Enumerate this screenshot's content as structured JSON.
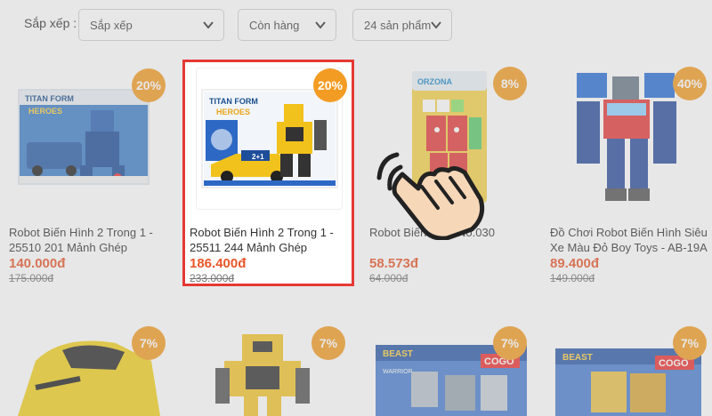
{
  "filters": {
    "sort_label": "Sắp xếp :",
    "sort_value": "Sắp xếp",
    "stock_value": "Còn hàng",
    "count_value": "24 sản phẩm"
  },
  "products": [
    {
      "name_line1": "Robot Biến Hình 2 Trong 1 -",
      "name_line2": "25510 201 Mảnh Ghép",
      "price": "140.000đ",
      "old_price": "175.000đ",
      "discount": "20%"
    },
    {
      "name_line1": "Robot Biến Hình 2 Trong 1 -",
      "name_line2": "25511 244 Mảnh Ghép",
      "price": "186.400đ",
      "old_price": "233.000đ",
      "discount": "20%"
    },
    {
      "name_line1": "Robot Biến Hình No.030",
      "name_line2": "",
      "price": "58.573đ",
      "old_price": "64.000đ",
      "discount": "8%"
    },
    {
      "name_line1": "Đồ Chơi Robot Biến Hình Siêu",
      "name_line2": "Xe Màu Đỏ Boy Toys - AB-19A",
      "price": "89.400đ",
      "old_price": "149.000đ",
      "discount": "40%"
    }
  ],
  "bottom_badges": [
    "7%",
    "7%",
    "7%",
    "7%"
  ],
  "box_texts": {
    "titan": "TITAN FORM",
    "heroes": "HEROES",
    "two_in_one": "2+1",
    "orzona": "ORZONA",
    "beast": "BEAST",
    "warrior": "WARRIOR",
    "cogo": "COGO"
  },
  "colors": {
    "accent_orange": "#f39c24",
    "price_red": "#e8562a",
    "highlight_border": "#e53935"
  }
}
